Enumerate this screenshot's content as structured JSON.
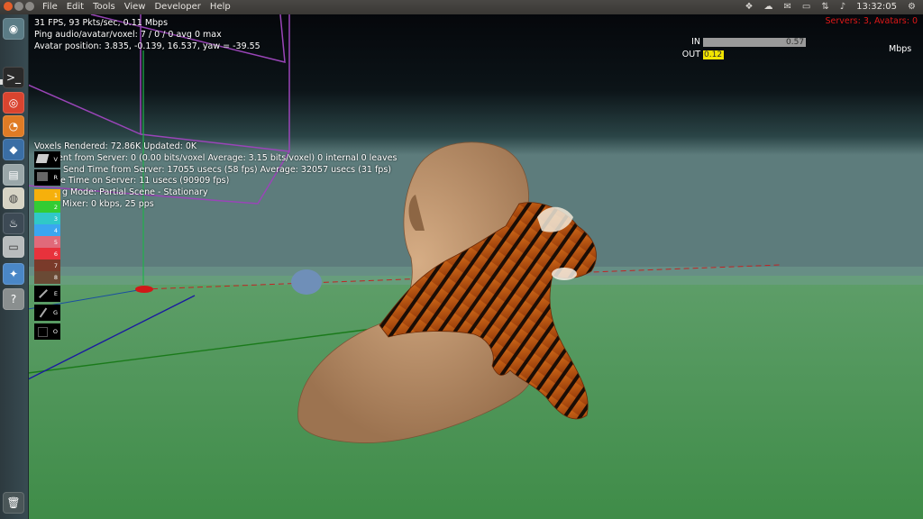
{
  "menubar": {
    "items": [
      "File",
      "Edit",
      "Tools",
      "View",
      "Developer",
      "Help"
    ],
    "tray_icons": [
      "dropbox-icon",
      "cloud-icon",
      "mail-icon",
      "battery-icon",
      "network-icon",
      "volume-icon"
    ],
    "clock": "13:32:05"
  },
  "launcher": {
    "items": [
      "dash-home-icon",
      "terminal-icon",
      "chrome-icon",
      "firefox-icon",
      "virtualbox-icon",
      "files-icon",
      "disk-icon",
      "steam-icon",
      "drive-icon",
      "pinwheel-icon",
      "help-icon",
      "trash-icon"
    ]
  },
  "stats": {
    "line1": "31 FPS, 93 Pkts/sec, 0.11 Mbps",
    "line2": "Ping audio/avatar/voxel: 7 / 0 / 0 avg 0 max",
    "line3": "Avatar position: 3.835, -0.139, 16.537, yaw = -39.55"
  },
  "voxel_stats": {
    "line1": "Voxels Rendered: 72.86K Updated: 0K",
    "line2": "Sent from Server: 0 (0.00 bits/voxel Average: 3.15 bits/voxel) 0 internal 0 leaves",
    "line3": "Send Time from Server: 17055 usecs (58 fps) Average: 32057 usecs (31 fps)",
    "line4": "e Time on Server: 11 usecs (90909 fps)",
    "line5": "g Mode: Partial Scene - Stationary",
    "line6": "Mixer: 0 kbps, 25 pps"
  },
  "servers": "Servers: 3, Avatars: 0",
  "bandwidth": {
    "in_label": "IN",
    "in_value": "0.57",
    "in_fraction": 1.0,
    "out_label": "OUT",
    "out_value": "0.12",
    "out_fraction": 0.2,
    "unit": "Mbps",
    "in_color": "#9a9a9a",
    "out_color": "#f2e400"
  },
  "palette": {
    "items": [
      {
        "label": "V",
        "icon": "voxel-add-icon",
        "color": "#000000"
      },
      {
        "label": "R",
        "icon": "voxel-delete-icon",
        "color": "#000000"
      },
      {
        "label": "1",
        "icon": "color-swatch-icon",
        "color": "#f6b00b"
      },
      {
        "label": "2",
        "icon": "color-swatch-icon",
        "color": "#33cc33"
      },
      {
        "label": "3",
        "icon": "color-swatch-icon",
        "color": "#30c8c8"
      },
      {
        "label": "4",
        "icon": "color-swatch-icon",
        "color": "#3aa6f0"
      },
      {
        "label": "5",
        "icon": "color-swatch-icon",
        "color": "#e06a7a"
      },
      {
        "label": "6",
        "icon": "color-swatch-icon",
        "color": "#e8323c"
      },
      {
        "label": "7",
        "icon": "color-swatch-icon",
        "color": "#7a3a2a"
      },
      {
        "label": "8",
        "icon": "color-swatch-icon",
        "color": "#6a4a35"
      },
      {
        "label": "E",
        "icon": "eyedropper-icon",
        "color": "#000000"
      },
      {
        "label": "G",
        "icon": "paint-icon",
        "color": "#000000"
      },
      {
        "label": "O",
        "icon": "select-icon",
        "color": "#000000"
      }
    ]
  },
  "colors": {
    "ground": "#4e9a5a",
    "sky_top": "#07090d",
    "sky_horizon": "#3f5e60",
    "menubar": "#3d3b38",
    "servers_text": "#e01818"
  }
}
